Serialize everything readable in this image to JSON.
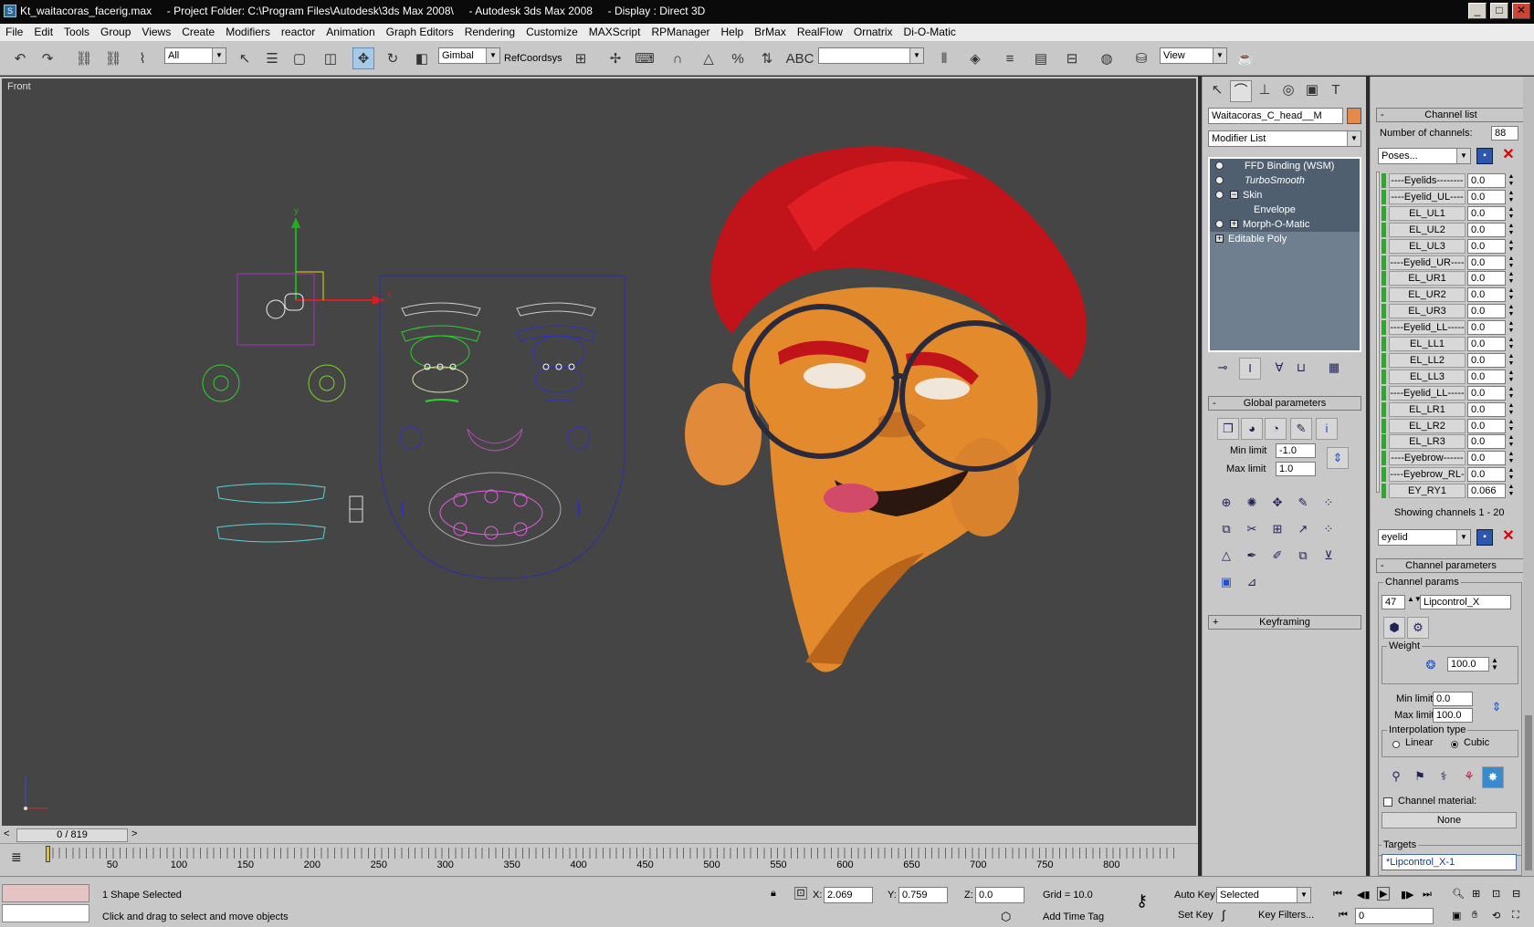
{
  "window": {
    "title": "Kt_waitacoras_facerig.max     - Project Folder: C:\\Program Files\\Autodesk\\3ds Max 2008\\     - Autodesk 3ds Max 2008     - Display : Direct 3D",
    "minimize": "_",
    "maximize": "□",
    "close": "✕"
  },
  "menu": [
    "File",
    "Edit",
    "Tools",
    "Group",
    "Views",
    "Create",
    "Modifiers",
    "reactor",
    "Animation",
    "Graph Editors",
    "Rendering",
    "Customize",
    "MAXScript",
    "RPManager",
    "Help",
    "BrMax",
    "RealFlow",
    "Ornatrix",
    "Di-O-Matic"
  ],
  "toolbar": {
    "selection_filter": "All",
    "transform_space": "Gimbal",
    "ref_coordsys": "RefCoordsys",
    "named_selection": "",
    "view_drop": "View"
  },
  "viewport": {
    "label": "Front",
    "axis_labels": {
      "y": "y",
      "x": "x"
    }
  },
  "timeslider": {
    "frame": "0 / 819",
    "prev": "<",
    "next": ">"
  },
  "trackbar": {
    "ticks": [
      "50",
      "100",
      "150",
      "200",
      "250",
      "300",
      "350",
      "400",
      "450",
      "500",
      "550",
      "600",
      "650",
      "700",
      "750",
      "800"
    ]
  },
  "status": {
    "selected": "1 Shape Selected",
    "prompt": "Click and drag to select and move objects",
    "x_label": "X:",
    "x_value": "2.069",
    "y_label": "Y:",
    "y_value": "0.759",
    "z_label": "Z:",
    "z_value": "0.0",
    "grid": "Grid = 10.0",
    "add_time_tag": "Add Time Tag",
    "auto_key": "Auto Key",
    "set_key": "Set Key",
    "key_mode": "Selected",
    "key_filters": "Key Filters...",
    "frame_field": "0"
  },
  "command_panel": {
    "object_name": "Waitacoras_C_head__M",
    "object_color": "#e5894a",
    "modifier_list": "Modifier List",
    "stack": [
      {
        "label": "FFD Binding (WSM)",
        "indent": 1,
        "bulb": true,
        "plus": false,
        "italic": false
      },
      {
        "label": "TurboSmooth",
        "indent": 1,
        "bulb": true,
        "plus": false,
        "italic": true
      },
      {
        "label": "Skin",
        "indent": 1,
        "bulb": true,
        "plus": true,
        "italic": false
      },
      {
        "label": "Envelope",
        "indent": 2,
        "bulb": false,
        "plus": false,
        "italic": false
      },
      {
        "label": "Morph-O-Matic",
        "indent": 1,
        "bulb": true,
        "plus": true,
        "italic": false
      },
      {
        "label": "Editable Poly",
        "indent": 0,
        "bulb": false,
        "plus": true,
        "italic": false
      }
    ],
    "global_params_title": "Global parameters",
    "min_limit_label": "Min limit",
    "min_limit": "-1.0",
    "max_limit_label": "Max limit",
    "max_limit": "1.0",
    "keyframing_title": "Keyframing"
  },
  "channel_panel": {
    "title": "Channel list",
    "num_channels_label": "Number of channels:",
    "num_channels": "88",
    "poses_drop": "Poses...",
    "channels": [
      {
        "name": "----Eyelids---------",
        "value": "0.0"
      },
      {
        "name": "----Eyelid_UL-------",
        "value": "0.0"
      },
      {
        "name": "EL_UL1",
        "value": "0.0"
      },
      {
        "name": "EL_UL2",
        "value": "0.0"
      },
      {
        "name": "EL_UL3",
        "value": "0.0"
      },
      {
        "name": "----Eyelid_UR-------",
        "value": "0.0"
      },
      {
        "name": "EL_UR1",
        "value": "0.0"
      },
      {
        "name": "EL_UR2",
        "value": "0.0"
      },
      {
        "name": "EL_UR3",
        "value": "0.0"
      },
      {
        "name": "----Eyelid_LL-------",
        "value": "0.0"
      },
      {
        "name": "EL_LL1",
        "value": "0.0"
      },
      {
        "name": "EL_LL2",
        "value": "0.0"
      },
      {
        "name": "EL_LL3",
        "value": "0.0"
      },
      {
        "name": "----Eyelid_LL-------",
        "value": "0.0"
      },
      {
        "name": "EL_LR1",
        "value": "0.0"
      },
      {
        "name": "EL_LR2",
        "value": "0.0"
      },
      {
        "name": "EL_LR3",
        "value": "0.0"
      },
      {
        "name": "----Eyebrow---------",
        "value": "0.0"
      },
      {
        "name": "----Eyebrow_RL------",
        "value": "0.0"
      },
      {
        "name": "EY_RY1",
        "value": "0.066"
      }
    ],
    "showing": "Showing channels 1 - 20",
    "filter_drop": "eyelid",
    "channel_params_title": "Channel parameters",
    "channel_params_group": "Channel params",
    "channel_index": "47",
    "channel_name": "Lipcontrol_X",
    "weight_label": "Weight",
    "weight": "100.0",
    "min_limit_label": "Min limit",
    "min_limit": "0.0",
    "max_limit_label": "Max limit",
    "max_limit": "100.0",
    "interp_label": "Interpolation type",
    "linear": "Linear",
    "cubic": "Cubic",
    "channel_material_label": "Channel material:",
    "material_button": "None",
    "targets_label": "Targets",
    "target_item": "*Lipcontrol_X-1"
  }
}
